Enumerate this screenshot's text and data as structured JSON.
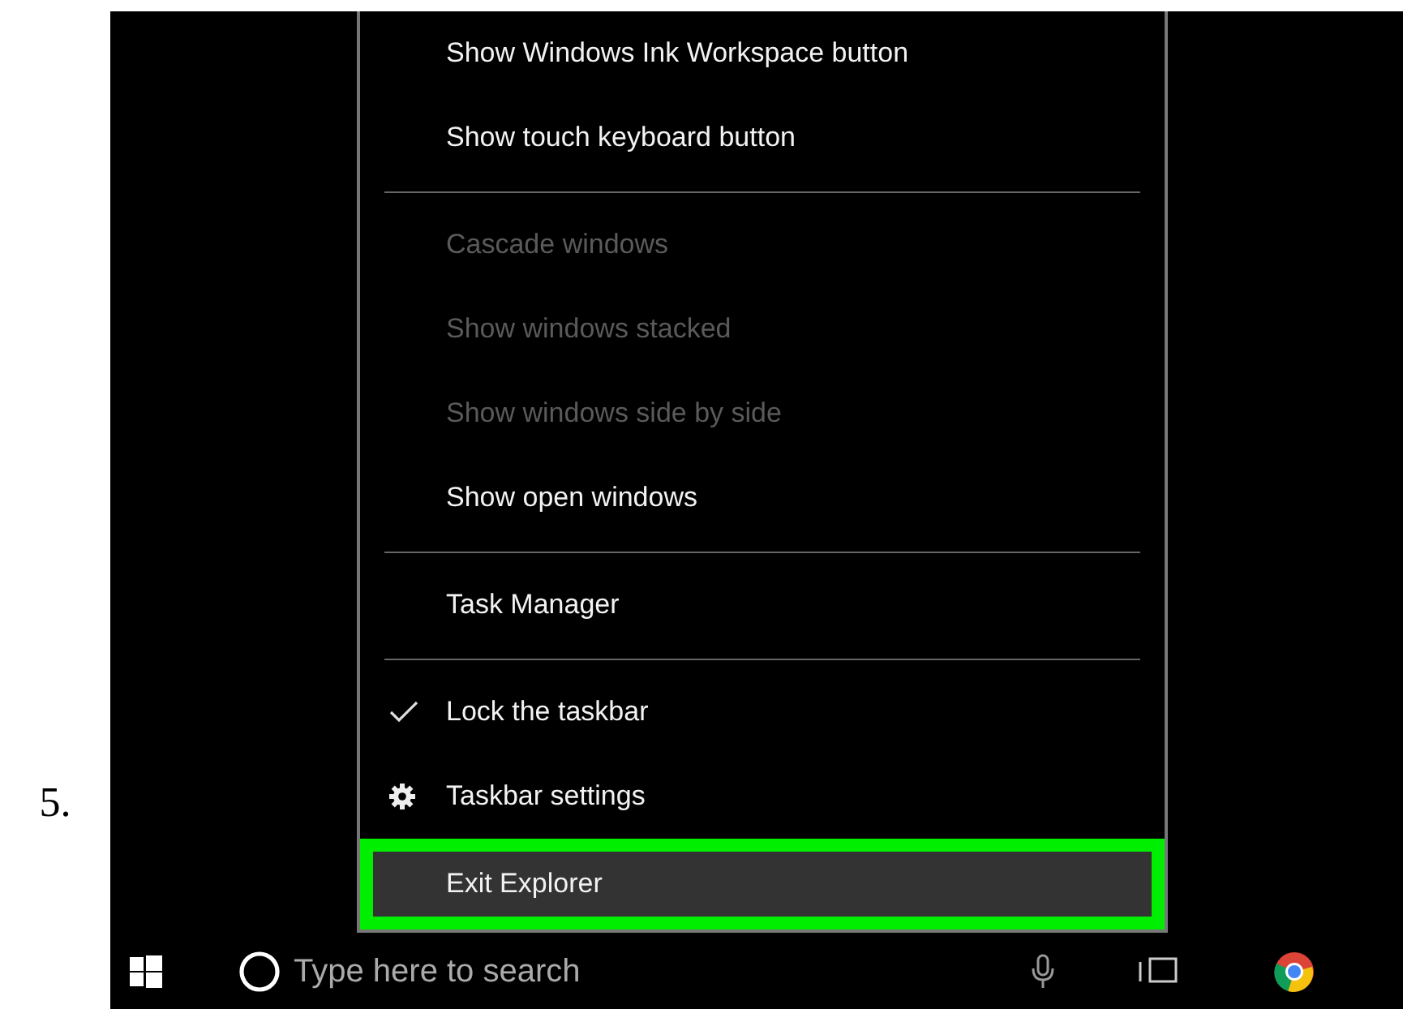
{
  "step_number": "5.",
  "context_menu": {
    "items": [
      {
        "kind": "plain",
        "label": "Show Windows Ink Workspace button",
        "disabled": false,
        "selected": false
      },
      {
        "kind": "plain",
        "label": "Show touch keyboard button",
        "disabled": false,
        "selected": false
      },
      {
        "kind": "separator"
      },
      {
        "kind": "plain",
        "label": "Cascade windows",
        "disabled": true,
        "selected": false
      },
      {
        "kind": "plain",
        "label": "Show windows stacked",
        "disabled": true,
        "selected": false
      },
      {
        "kind": "plain",
        "label": "Show windows side by side",
        "disabled": true,
        "selected": false
      },
      {
        "kind": "plain",
        "label": "Show open windows",
        "disabled": false,
        "selected": false
      },
      {
        "kind": "separator"
      },
      {
        "kind": "plain",
        "label": "Task Manager",
        "disabled": false,
        "selected": false
      },
      {
        "kind": "separator"
      },
      {
        "kind": "check",
        "label": "Lock the taskbar",
        "checked": true,
        "disabled": false,
        "selected": false
      },
      {
        "kind": "gear",
        "label": "Taskbar settings",
        "disabled": false,
        "selected": false
      },
      {
        "kind": "plain",
        "label": "Exit Explorer",
        "disabled": false,
        "selected": true
      }
    ]
  },
  "taskbar": {
    "search": {
      "placeholder": "Type here to search"
    }
  }
}
